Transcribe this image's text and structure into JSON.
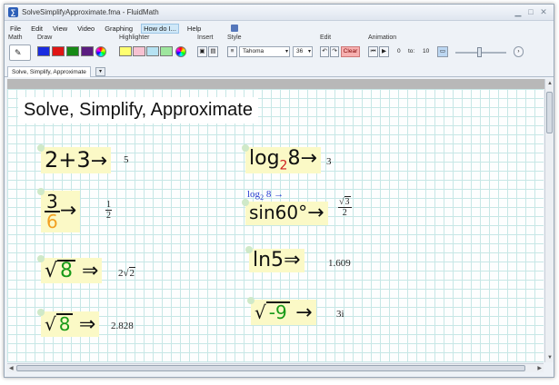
{
  "window": {
    "title": "SolveSimplifyApproximate.fma - FluidMath"
  },
  "menu": [
    "File",
    "Edit",
    "View",
    "Video",
    "Graphing",
    "How do I...",
    "Help"
  ],
  "toolbar": {
    "math_label": "Math",
    "draw_label": "Draw",
    "draw_colors": [
      "#1a2ce0",
      "#e01515",
      "#168a16",
      "#5a1d80"
    ],
    "highlighter_label": "Highlighter",
    "highlighter_colors": [
      "#ffff70",
      "#f7c2d2",
      "#b5e2f2",
      "#9ee69e",
      "#dcb5ee"
    ],
    "insert_label": "Insert",
    "style_label": "Style",
    "font_name": "Tahoma",
    "font_size": "36",
    "edit_label": "Edit",
    "clear_label": "Clear",
    "animation_label": "Animation",
    "anim_from": "0",
    "anim_to_label": "to:",
    "anim_to": "10"
  },
  "tab": {
    "label": "Solve, Simplify, Approximate"
  },
  "canvas": {
    "title": "Solve, Simplify, Approximate",
    "items": {
      "add": {
        "expr_a": "2+3",
        "arrow": "→",
        "result": "5"
      },
      "frac": {
        "num": "3",
        "den": "6",
        "arrow": "→",
        "res_num": "1",
        "res_den": "2"
      },
      "sqrt1": {
        "radicand": "8",
        "arrow": "⇒",
        "result_coef": "2",
        "result_rad": "2"
      },
      "sqrt2": {
        "radicand": "8",
        "arrow": "⇒",
        "result": "2.828"
      },
      "log": {
        "fn": "log",
        "base": "2",
        "arg": "8",
        "arrow": "→",
        "result": "3"
      },
      "log_typed": {
        "fn": "log",
        "base": "2",
        "arg": "8",
        "arrow": "→"
      },
      "sin": {
        "expr": "sin60°",
        "arrow": "→",
        "res_num": "3",
        "res_den": "2"
      },
      "ln": {
        "expr": "ln5",
        "arrow": "⇒",
        "result": "1.609"
      },
      "sqrtneg": {
        "radicand": "-9",
        "arrow": "→",
        "result": "3i"
      }
    }
  }
}
